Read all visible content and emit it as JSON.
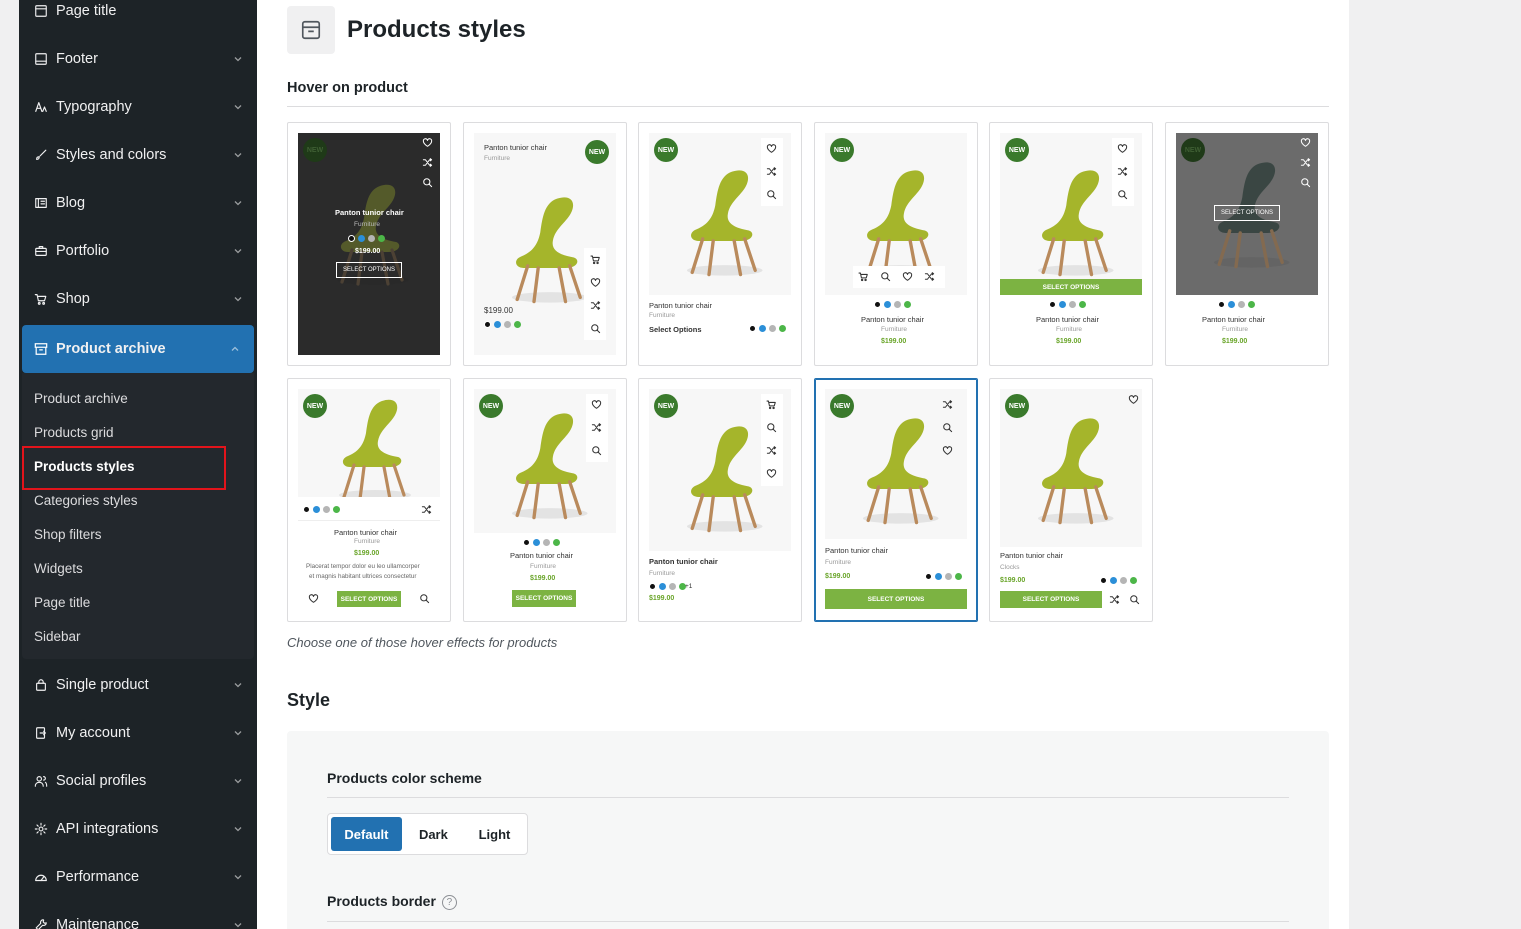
{
  "sidebar": {
    "items_top": [
      {
        "label": "Page title",
        "icon": "page-title-icon"
      },
      {
        "label": "Footer",
        "icon": "footer-icon"
      },
      {
        "label": "Typography",
        "icon": "typography-icon"
      },
      {
        "label": "Styles and colors",
        "icon": "brush-icon"
      },
      {
        "label": "Blog",
        "icon": "blog-icon"
      },
      {
        "label": "Portfolio",
        "icon": "portfolio-icon"
      },
      {
        "label": "Shop",
        "icon": "cart-icon"
      }
    ],
    "active": {
      "label": "Product archive",
      "icon": "archive-icon"
    },
    "submenu": [
      "Product archive",
      "Products grid",
      "Products styles",
      "Categories styles",
      "Shop filters",
      "Widgets",
      "Page title",
      "Sidebar"
    ],
    "current_submenu": "Products styles",
    "items_bottom": [
      {
        "label": "Single product",
        "icon": "bag-icon"
      },
      {
        "label": "My account",
        "icon": "account-icon"
      },
      {
        "label": "Social profiles",
        "icon": "social-icon"
      },
      {
        "label": "API integrations",
        "icon": "api-icon"
      },
      {
        "label": "Performance",
        "icon": "performance-icon"
      },
      {
        "label": "Maintenance",
        "icon": "wrench-icon"
      }
    ]
  },
  "main": {
    "title": "Products styles",
    "hover_label": "Hover on product",
    "help_text": "Choose one of those hover effects for products",
    "style_title": "Style",
    "color_scheme_label": "Products color scheme",
    "color_scheme_options": [
      "Default",
      "Dark",
      "Light"
    ],
    "color_scheme_selected": "Default",
    "border_label": "Products border",
    "border_help": "?"
  },
  "product": {
    "name": "Panton tunior chair",
    "category": "Furniture",
    "category_alt": "Clocks",
    "price": "$199.00",
    "badge": "NEW",
    "select_options": "SELECT OPTIONS",
    "select_options_text": "Select Options",
    "excerpt_1": "Placerat tempor dolor eu leo ullamcorper",
    "excerpt_2": "et magnis habitant ultrices consectetur",
    "more_colors": "+1",
    "swatch_colors": [
      "#111111",
      "#2b8fd8",
      "#b5b5b5",
      "#4cb648"
    ]
  },
  "colors": {
    "accent": "#2271b1",
    "sidebar_bg": "#1d2327",
    "green": "#7cb342",
    "badge": "#3a7a2c",
    "highlight": "#e2141b"
  }
}
